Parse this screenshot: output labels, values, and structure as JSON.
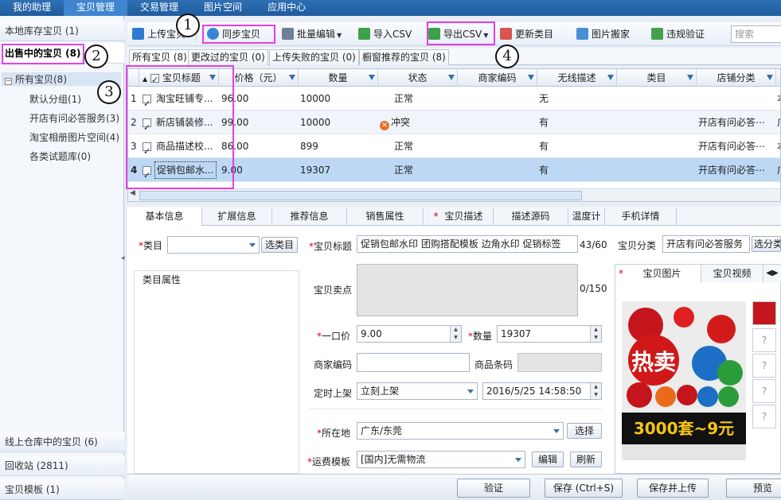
{
  "topnav": {
    "tabs": [
      "我的助理",
      "宝贝管理",
      "交易管理",
      "图片空间",
      "应用中心"
    ]
  },
  "sidebar": {
    "local_stock": "本地库存宝贝 (1)",
    "on_sale": "出售中的宝贝 (8)",
    "tree": {
      "root": "所有宝贝(8)",
      "children": [
        "默认分组(1)",
        "开店有问必答服务(3)",
        "淘宝相册图片空间(4)",
        "各类试题库(0)"
      ]
    },
    "online_warehouse": "线上仓库中的宝贝 (6)",
    "recycle": "回收站 (2811)",
    "templates": "宝贝模板 (1)"
  },
  "toolbar": {
    "upload": "上传宝贝",
    "sync": "同步宝贝",
    "batch_edit": "批量编辑",
    "import_csv": "导入CSV",
    "export_csv": "导出CSV",
    "update_category": "更新类目",
    "image_move": "图片搬家",
    "violation_check": "违规验证",
    "search_placeholder": "搜索"
  },
  "subtabs": [
    "所有宝贝 (8)",
    "更改过的宝贝 (0)",
    "上传失败的宝贝 (0)",
    "橱窗推荐的宝贝 (8)"
  ],
  "grid": {
    "columns": [
      "宝贝标题",
      "价格（元）",
      "数量",
      "状态",
      "商家编码",
      "无线描述",
      "类目",
      "店铺分类"
    ],
    "rows": [
      {
        "num": "1",
        "title": "淘宝旺铺专...",
        "price": "96.00",
        "qty": "10000",
        "status": "正常",
        "wireless": "无",
        "shop_cat": "",
        "extra": "本"
      },
      {
        "num": "2",
        "title": "新店铺装修...",
        "price": "99.00",
        "qty": "10000",
        "status": "冲突",
        "wireless": "有",
        "shop_cat": "开店有问必答⋯",
        "extra": "广"
      },
      {
        "num": "3",
        "title": "商品描述校...",
        "price": "86.00",
        "qty": "899",
        "status": "正常",
        "wireless": "有",
        "shop_cat": "开店有问必答⋯",
        "extra": "本"
      },
      {
        "num": "4",
        "title": "促销包邮水...",
        "price": "9.00",
        "qty": "19307",
        "status": "正常",
        "wireless": "有",
        "shop_cat": "开店有问必答⋯",
        "extra": "广"
      }
    ]
  },
  "detail_tabs": [
    "基本信息",
    "扩展信息",
    "推荐信息",
    "销售属性",
    "宝贝描述",
    "描述源码",
    "温度计",
    "手机详情"
  ],
  "form": {
    "category_label": "类目",
    "select_category": "选类目",
    "category_attr": "类目属性",
    "title_label": "宝贝标题",
    "title_value": "促销包邮水印 团购搭配模板 边角水印 促销标签",
    "title_count": "43/60",
    "selling_point_label": "宝贝卖点",
    "selling_point_count": "0/150",
    "price_label": "一口价",
    "price_value": "9.00",
    "qty_label": "数量",
    "qty_value": "19307",
    "merchant_code_label": "商家编码",
    "barcode_label": "商品条码",
    "schedule_label": "定时上架",
    "schedule_value": "立刻上架",
    "schedule_time": "2016/5/25 14:58:50",
    "location_label": "所在地",
    "location_value": "广东/东莞",
    "location_btn": "选择",
    "shipping_label": "运费模板",
    "shipping_value": "[国内]无需物流",
    "edit_btn": "编辑",
    "refresh_btn": "刷新",
    "shop_cat_label": "宝贝分类",
    "shop_cat_value": "开店有问必答服务",
    "shop_cat_btn": "选分类"
  },
  "pic_panel": {
    "tab_images": "宝贝图片",
    "tab_video": "宝贝视频",
    "slogan": "3000套~9元",
    "big_char": "热卖",
    "slots": [
      "?",
      "?",
      "?",
      "?"
    ]
  },
  "actions": {
    "verify": "验证",
    "save": "保存 (Ctrl+S)",
    "save_upload": "保存并上传",
    "preview": "预览"
  },
  "annotations": [
    "1",
    "2",
    "3",
    "4"
  ],
  "colors": {
    "nav": "#1f5c9e",
    "annotation_box": "#e63ee6",
    "selected_row": "#bcd8f4",
    "required": "#d0021b"
  }
}
